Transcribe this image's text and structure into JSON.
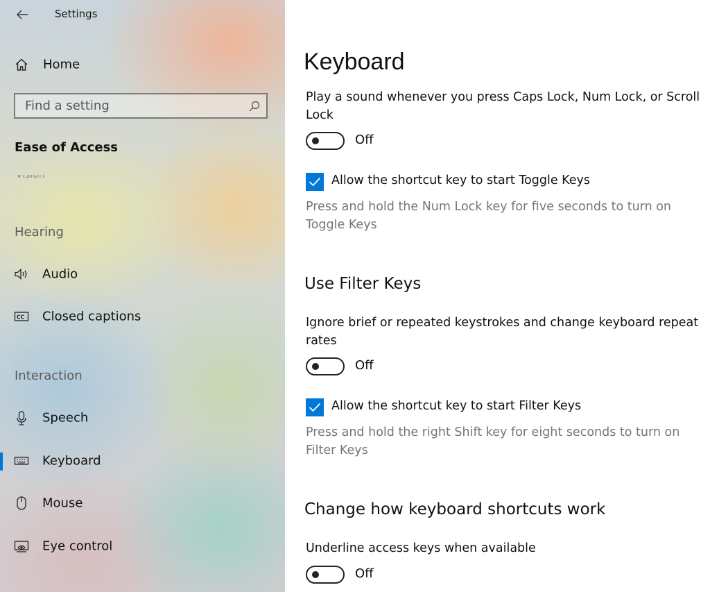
{
  "window": {
    "title": "Settings"
  },
  "sidebar": {
    "home_label": "Home",
    "search": {
      "placeholder": "Find a setting"
    },
    "category": "Ease of Access",
    "cutoff_text": "Vision",
    "sections": {
      "hearing": "Hearing",
      "interaction": "Interaction"
    },
    "items": {
      "audio": "Audio",
      "closed_captions": "Closed captions",
      "speech": "Speech",
      "keyboard": "Keyboard",
      "mouse": "Mouse",
      "eye_control": "Eye control"
    },
    "selected": "keyboard",
    "accent_color": "#0078d7"
  },
  "main": {
    "title": "Keyboard",
    "toggle_keys": {
      "description": "Play a sound whenever you press Caps Lock, Num Lock, or Scroll Lock",
      "toggle_state": "Off",
      "shortcut_checkbox_label": "Allow the shortcut key to start Toggle Keys",
      "shortcut_checked": true,
      "shortcut_help": "Press and hold the Num Lock key for five seconds to turn on Toggle Keys"
    },
    "filter_keys": {
      "heading": "Use Filter Keys",
      "description": "Ignore brief or repeated keystrokes and change keyboard repeat rates",
      "toggle_state": "Off",
      "shortcut_checkbox_label": "Allow the shortcut key to start Filter Keys",
      "shortcut_checked": true,
      "shortcut_help": "Press and hold the right Shift key for eight seconds to turn on Filter Keys"
    },
    "shortcuts": {
      "heading": "Change how keyboard shortcuts work",
      "description": "Underline access keys when available",
      "toggle_state": "Off"
    }
  }
}
